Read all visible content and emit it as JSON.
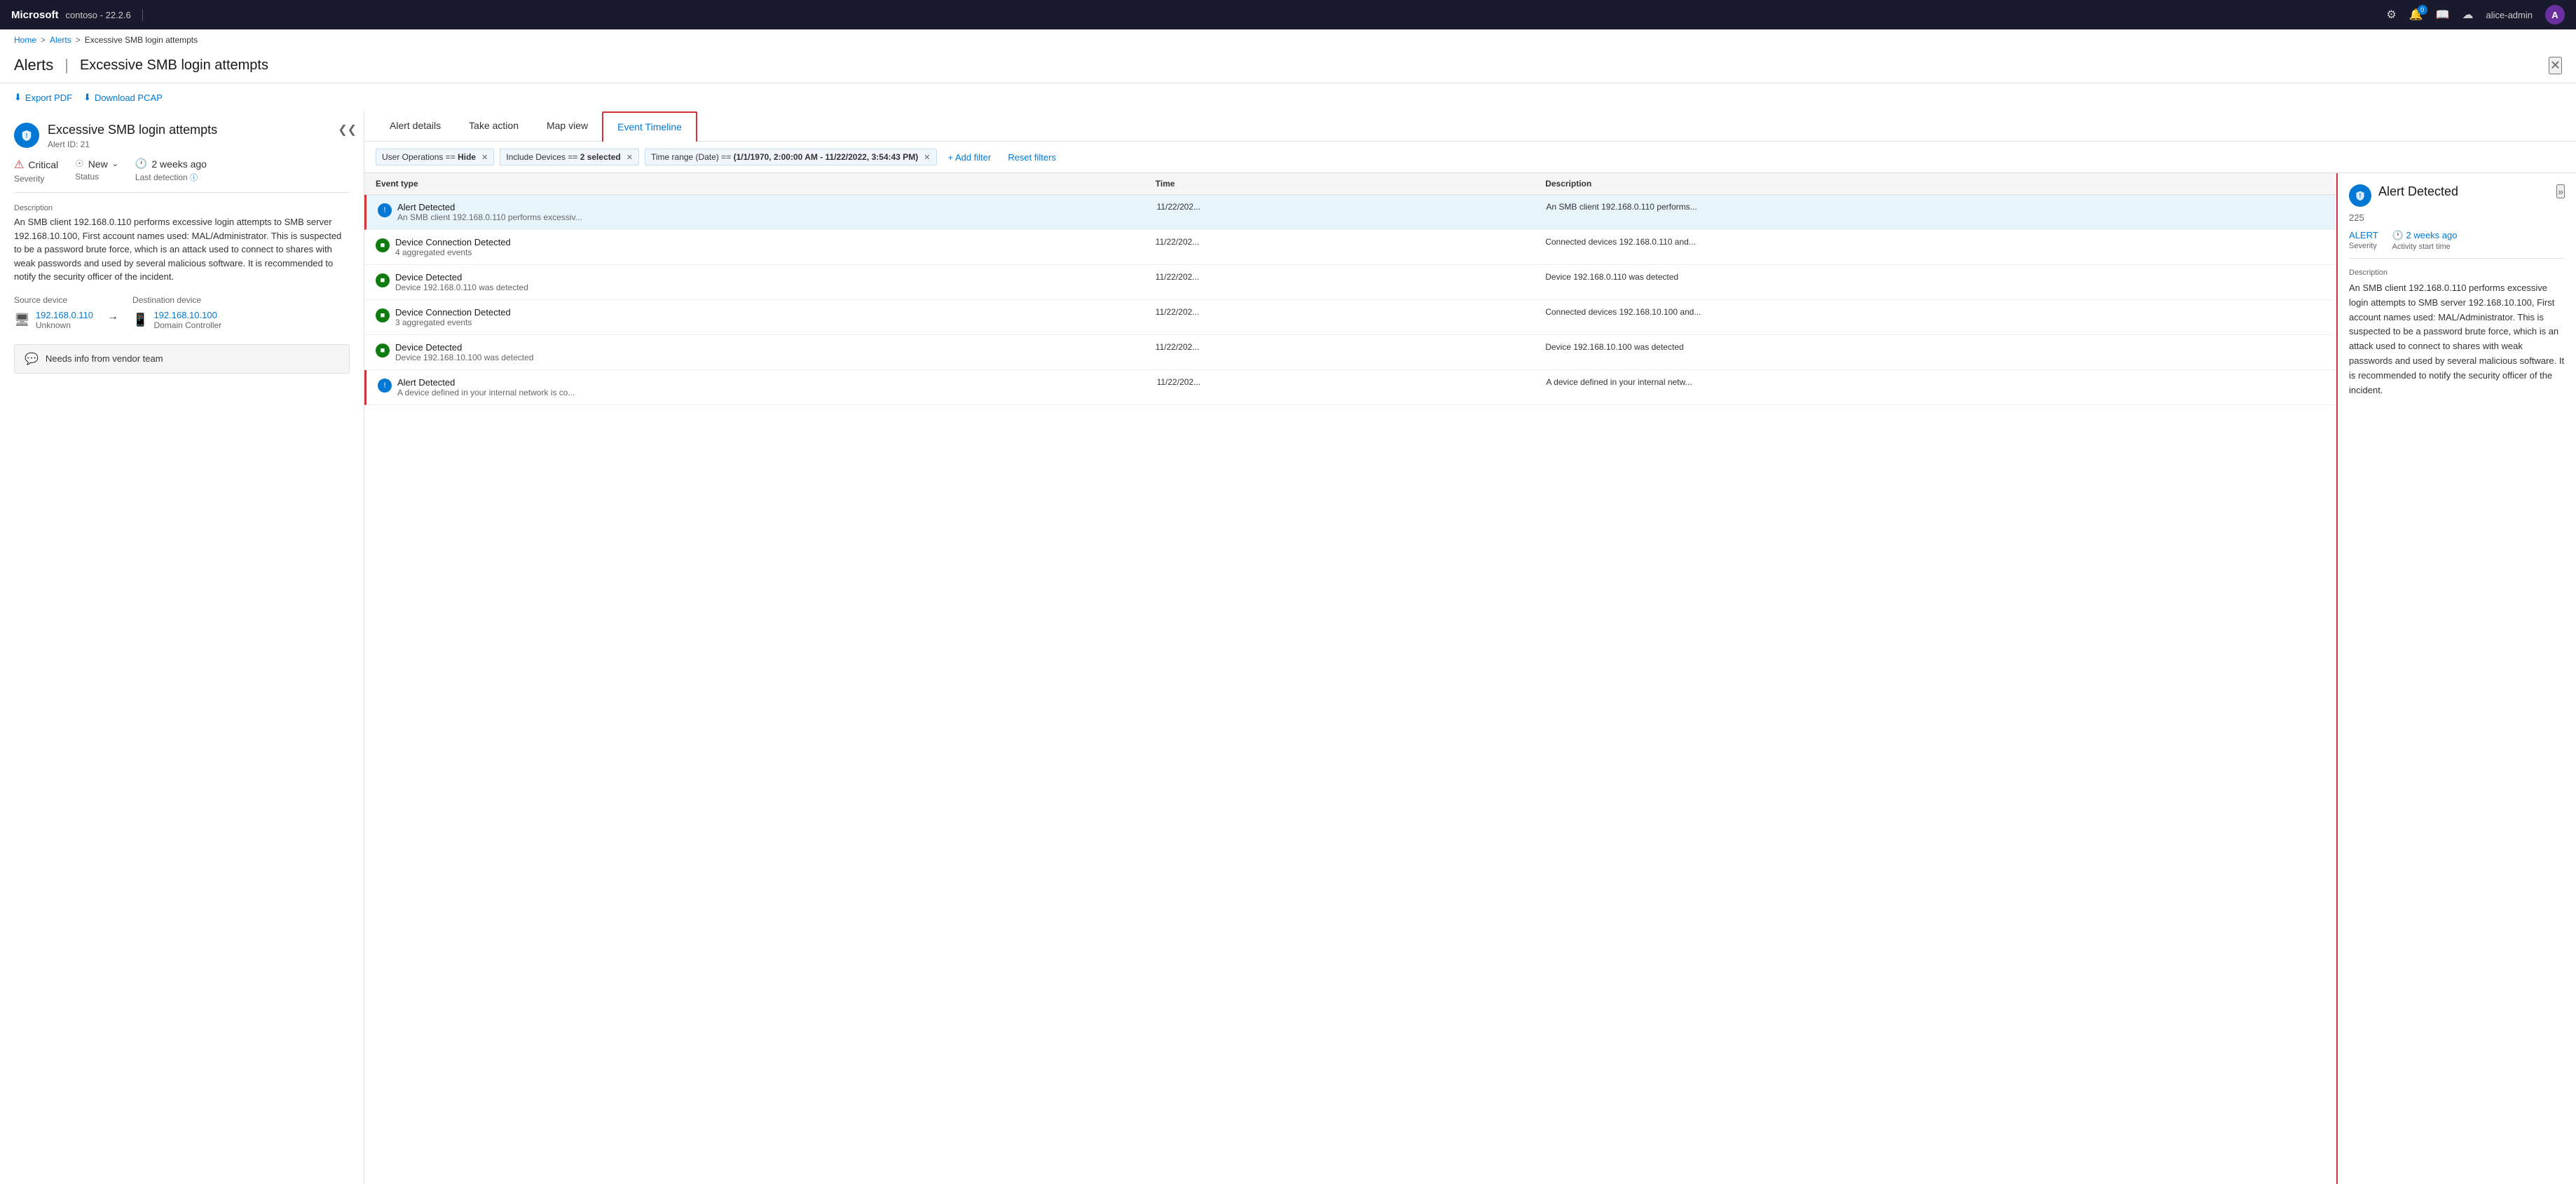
{
  "topbar": {
    "brand": "Microsoft",
    "separator": "|",
    "version_label": "contoso - 22.2.6",
    "username": "alice-admin",
    "avatar_initials": "A",
    "notification_count": "0"
  },
  "breadcrumb": {
    "home": "Home",
    "alerts": "Alerts",
    "current": "Excessive SMB login attempts"
  },
  "page": {
    "title": "Alerts",
    "divider": "|",
    "subtitle": "Excessive SMB login attempts",
    "close_label": "✕"
  },
  "toolbar": {
    "export_pdf": "Export PDF",
    "download_pcap": "Download PCAP"
  },
  "left_panel": {
    "alert_title": "Excessive SMB login attempts",
    "alert_id": "Alert ID: 21",
    "severity_value": "Critical",
    "severity_label": "Severity",
    "status_value": "New",
    "status_label": "Status",
    "detection_value": "2 weeks ago",
    "detection_label": "Last detection",
    "description_label": "Description",
    "description_text": "An SMB client 192.168.0.110 performs excessive login attempts to SMB server 192.168.10.100, First account names used: MAL/Administrator. This is suspected to be a password brute force, which is an attack used to connect to shares with weak passwords and used by several malicious software. It is recommended to notify the security officer of the incident.",
    "source_label": "Source device",
    "source_ip": "192.168.0.110",
    "source_type": "Unknown",
    "dest_label": "Destination device",
    "dest_ip": "192.168.10.100",
    "dest_type": "Domain Controller",
    "needs_info": "Needs info from vendor team"
  },
  "tabs": [
    {
      "id": "alert-details",
      "label": "Alert details"
    },
    {
      "id": "take-action",
      "label": "Take action"
    },
    {
      "id": "map-view",
      "label": "Map view"
    },
    {
      "id": "event-timeline",
      "label": "Event Timeline",
      "active": true
    }
  ],
  "filters": [
    {
      "key": "User Operations",
      "op": "==",
      "value": "Hide",
      "removable": true
    },
    {
      "key": "Include Devices",
      "op": "==",
      "value": "2 selected",
      "removable": true
    },
    {
      "key": "Time range (Date)",
      "op": "==",
      "value": "(1/1/1970, 2:00:00 AM - 11/22/2022, 3:54:43 PM)",
      "removable": true
    }
  ],
  "add_filter_label": "+ Add filter",
  "reset_filters_label": "Reset filters",
  "table": {
    "headers": [
      "Event type",
      "Time",
      "Description"
    ],
    "rows": [
      {
        "type": "Alert Detected",
        "subtext": "An SMB client 192.168.0.110 performs excessiv...",
        "time": "11/22/202...",
        "description": "An SMB client 192.168.0.110 performs...",
        "icon_type": "shield",
        "is_alert": true,
        "selected": true
      },
      {
        "type": "Device Connection Detected",
        "subtext": "4 aggregated events",
        "time": "11/22/202...",
        "description": "Connected devices 192.168.0.110 and...",
        "icon_type": "device",
        "is_alert": false,
        "selected": false
      },
      {
        "type": "Device Detected",
        "subtext": "Device 192.168.0.110 was detected",
        "time": "11/22/202...",
        "description": "Device 192.168.0.110 was detected",
        "icon_type": "device",
        "is_alert": false,
        "selected": false
      },
      {
        "type": "Device Connection Detected",
        "subtext": "3 aggregated events",
        "time": "11/22/202...",
        "description": "Connected devices 192.168.10.100 and...",
        "icon_type": "device",
        "is_alert": false,
        "selected": false
      },
      {
        "type": "Device Detected",
        "subtext": "Device 192.168.10.100 was detected",
        "time": "11/22/202...",
        "description": "Device 192.168.10.100 was detected",
        "icon_type": "device",
        "is_alert": false,
        "selected": false
      },
      {
        "type": "Alert Detected",
        "subtext": "A device defined in your internal network is co...",
        "time": "11/22/202...",
        "description": "A device defined in your internal netw...",
        "icon_type": "shield",
        "is_alert": true,
        "selected": false
      }
    ]
  },
  "detail": {
    "title": "Alert Detected",
    "count": "225",
    "severity_value": "ALERT",
    "severity_label": "Severity",
    "time_value": "2 weeks ago",
    "time_label": "Activity start time",
    "description_label": "Description",
    "description_text": "An SMB client 192.168.0.110 performs excessive login attempts to SMB server 192.168.10.100, First account names used: MAL/Administrator. This is suspected to be a password brute force, which is an attack used to connect to shares with weak passwords and used by several malicious software. It is recommended to notify the security officer of the incident."
  }
}
